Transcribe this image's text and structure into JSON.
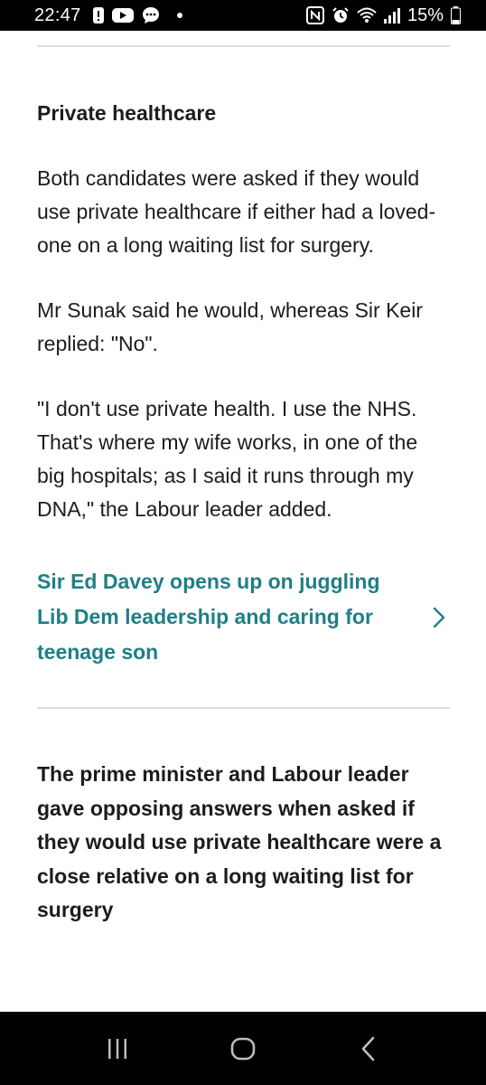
{
  "status_bar": {
    "time": "22:47",
    "battery_percent": "15%",
    "left_icons": [
      "notification-icon",
      "youtube-icon",
      "chat-icon"
    ],
    "right_icons": [
      "nfc-icon",
      "alarm-icon",
      "wifi-icon",
      "signal-icon",
      "battery-icon"
    ]
  },
  "article": {
    "subheading": "Private healthcare",
    "paragraphs": [
      "Both candidates were asked if they would use private healthcare if either had a loved-one on a long waiting list for surgery.",
      "Mr Sunak said he would, whereas Sir Keir replied: \"No\".",
      "\"I don't use private health. I use the NHS. That's where my wife works, in one of the big hospitals; as I said it runs through my DNA,\" the Labour leader added."
    ],
    "related_link": {
      "text": "Sir Ed Davey opens up on juggling Lib Dem leadership and caring for teenage son",
      "icon": "chevron-right-icon"
    },
    "caption": "The prime minister and Labour leader gave opposing answers when asked if they would use private healthcare were a close relative on a long waiting list for surgery"
  },
  "nav_bar": {
    "buttons": [
      "recents-icon",
      "home-icon",
      "back-icon"
    ]
  },
  "colors": {
    "text": "#1c1c1c",
    "link": "#1f7f86",
    "divider": "#dcdcdc",
    "system_bars": "#000000"
  }
}
